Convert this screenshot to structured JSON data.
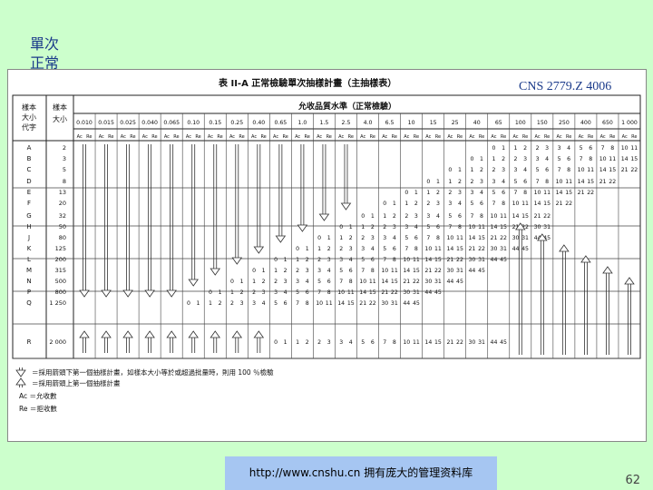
{
  "slide": {
    "title_line1": "單次",
    "title_line2": "正常",
    "standard_no": "CNS 2779.Z 4006",
    "footer_link": "http://www.cnshu.cn  拥有庞大的管理资料库",
    "page_number": "62"
  },
  "table": {
    "caption": "表 II-A    正常檢驗單次抽樣計畫（主抽樣表）",
    "aql_header": "允收品質水準（正常檢驗）",
    "col_code_header": "樣本大小代字",
    "col_size_header": "樣本大小",
    "ac_label": "Ac",
    "re_label": "Re",
    "aql_values": [
      "0.010",
      "0.015",
      "0.025",
      "0.040",
      "0.065",
      "0.10",
      "0.15",
      "0.25",
      "0.40",
      "0.65",
      "1.0",
      "1.5",
      "2.5",
      "4.0",
      "6.5",
      "10",
      "15",
      "25",
      "40",
      "65",
      "100",
      "150",
      "250",
      "400",
      "650",
      "1 000"
    ],
    "rows": [
      {
        "code": "A",
        "size": "2"
      },
      {
        "code": "B",
        "size": "3"
      },
      {
        "code": "C",
        "size": "5"
      },
      {
        "code": "D",
        "size": "8"
      },
      {
        "code": "E",
        "size": "13"
      },
      {
        "code": "F",
        "size": "20"
      },
      {
        "code": "G",
        "size": "32"
      },
      {
        "code": "H",
        "size": "50"
      },
      {
        "code": "J",
        "size": "80"
      },
      {
        "code": "K",
        "size": "125"
      },
      {
        "code": "L",
        "size": "200"
      },
      {
        "code": "M",
        "size": "315"
      },
      {
        "code": "N",
        "size": "500"
      },
      {
        "code": "P",
        "size": "800"
      },
      {
        "code": "Q",
        "size": "1 250"
      },
      {
        "code": "R",
        "size": "2 000"
      }
    ],
    "plan_labels": [
      "0 1",
      "1 2",
      "2 3",
      "3 4",
      "5 6",
      "7 8",
      "10 11",
      "14 15",
      "21 22",
      "30 31",
      "44 45"
    ],
    "legend": {
      "down": "＝採用箭頭下第一個抽樣計畫，如樣本大小等於或超過批量時，則用 100 ％檢驗",
      "up": "＝採用箭頭上第一個抽樣計畫",
      "ac": "Ac ＝允收數",
      "re": "Re ＝拒收數"
    }
  }
}
